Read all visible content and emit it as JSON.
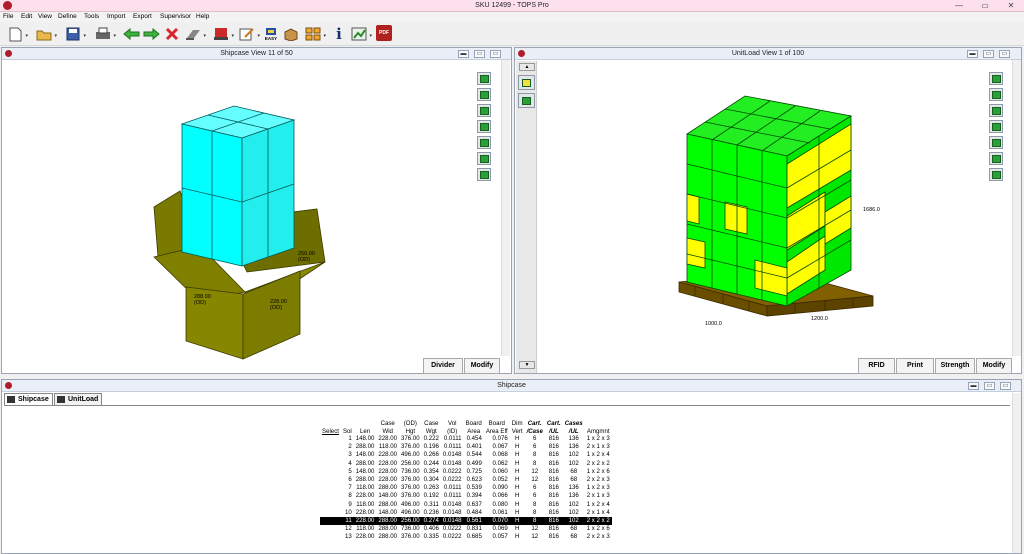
{
  "window": {
    "title": "SKU 12499 - TOPS Pro",
    "controls": [
      "—",
      "▭",
      "✕"
    ]
  },
  "menu": [
    "File",
    "Edit",
    "View",
    "Define",
    "Tools",
    "Import",
    "Export",
    "Supervisor",
    "Help"
  ],
  "toolbar": {
    "easy_label": "EASY",
    "info_label": "i",
    "pdf_label": "PDF"
  },
  "shipcase_view": {
    "title": "Shipcase View  11 of 50",
    "dim_height": "256.00\n(OD)",
    "dim_length": "288.00\n(OD)",
    "dim_width": "228.00\n(OD)",
    "buttons": [
      "Divider",
      "Modify"
    ],
    "colors": {
      "cases": "#00ffff",
      "box": "#808000"
    }
  },
  "unitload_view": {
    "title": "UnitLoad View  1 of 100",
    "dim_height": "1686.0",
    "dim_length": "1000.0",
    "dim_width": "1200.0",
    "buttons": [
      "RFID",
      "Print",
      "Strength",
      "Modify"
    ],
    "colors": {
      "case_green": "#00ff00",
      "case_yellow": "#ffff00",
      "pallet": "#806000"
    }
  },
  "shipcase_panel": {
    "title": "Shipcase",
    "tabs": [
      "Shipcase",
      "UnitLoad"
    ],
    "headers": [
      [
        "",
        "Select"
      ],
      [
        "",
        "Sol"
      ],
      [
        "",
        "Len"
      ],
      [
        "Case",
        "Wid"
      ],
      [
        "(OD)",
        "Hgt"
      ],
      [
        "Case",
        "Wgt"
      ],
      [
        "Vol",
        "(ID)"
      ],
      [
        "Board",
        "Area"
      ],
      [
        "Board",
        "Area Eff"
      ],
      [
        "Dim",
        "Vert"
      ],
      [
        "Cart.",
        "/Case"
      ],
      [
        "Cart.",
        "/UL"
      ],
      [
        "Cases",
        "/UL"
      ],
      [
        "",
        "Amgmnt"
      ]
    ],
    "rows": [
      [
        "",
        "1",
        "148.00",
        "228.00",
        "376.00",
        "0.222",
        "0.0111",
        "0.454",
        "0.076",
        "H",
        "6",
        "816",
        "136",
        "1 x 2 x 3"
      ],
      [
        "",
        "2",
        "288.00",
        "118.00",
        "376.00",
        "0.196",
        "0.0111",
        "0.401",
        "0.067",
        "H",
        "6",
        "816",
        "136",
        "2 x 1 x 3"
      ],
      [
        "",
        "3",
        "148.00",
        "228.00",
        "496.00",
        "0.266",
        "0.0148",
        "0.544",
        "0.068",
        "H",
        "8",
        "816",
        "102",
        "1 x 2 x 4"
      ],
      [
        "",
        "4",
        "288.00",
        "228.00",
        "256.00",
        "0.244",
        "0.0148",
        "0.499",
        "0.062",
        "H",
        "8",
        "816",
        "102",
        "2 x 2 x 2"
      ],
      [
        "",
        "5",
        "148.00",
        "228.00",
        "736.00",
        "0.354",
        "0.0222",
        "0.725",
        "0.060",
        "H",
        "12",
        "816",
        "68",
        "1 x 2 x 6"
      ],
      [
        "",
        "6",
        "288.00",
        "228.00",
        "376.00",
        "0.304",
        "0.0222",
        "0.623",
        "0.052",
        "H",
        "12",
        "816",
        "68",
        "2 x 2 x 3"
      ],
      [
        "",
        "7",
        "118.00",
        "288.00",
        "376.00",
        "0.263",
        "0.0111",
        "0.539",
        "0.090",
        "H",
        "6",
        "816",
        "136",
        "1 x 2 x 3"
      ],
      [
        "",
        "8",
        "228.00",
        "148.00",
        "376.00",
        "0.192",
        "0.0111",
        "0.394",
        "0.066",
        "H",
        "6",
        "816",
        "136",
        "2 x 1 x 3"
      ],
      [
        "",
        "9",
        "118.00",
        "288.00",
        "496.00",
        "0.311",
        "0.0148",
        "0.637",
        "0.080",
        "H",
        "8",
        "816",
        "102",
        "1 x 2 x 4"
      ],
      [
        "",
        "10",
        "228.00",
        "148.00",
        "496.00",
        "0.236",
        "0.0148",
        "0.484",
        "0.061",
        "H",
        "8",
        "816",
        "102",
        "2 x 1 x 4"
      ],
      [
        "",
        "11",
        "228.00",
        "288.00",
        "256.00",
        "0.274",
        "0.0148",
        "0.561",
        "0.070",
        "H",
        "8",
        "816",
        "102",
        "2 x 2 x 2"
      ],
      [
        "",
        "12",
        "118.00",
        "288.00",
        "736.00",
        "0.406",
        "0.0222",
        "0.831",
        "0.069",
        "H",
        "12",
        "816",
        "68",
        "1 x 2 x 6"
      ],
      [
        "",
        "13",
        "228.00",
        "288.00",
        "376.00",
        "0.335",
        "0.0222",
        "0.685",
        "0.057",
        "H",
        "12",
        "816",
        "68",
        "2 x 2 x 3"
      ]
    ],
    "selected_row": 11
  }
}
